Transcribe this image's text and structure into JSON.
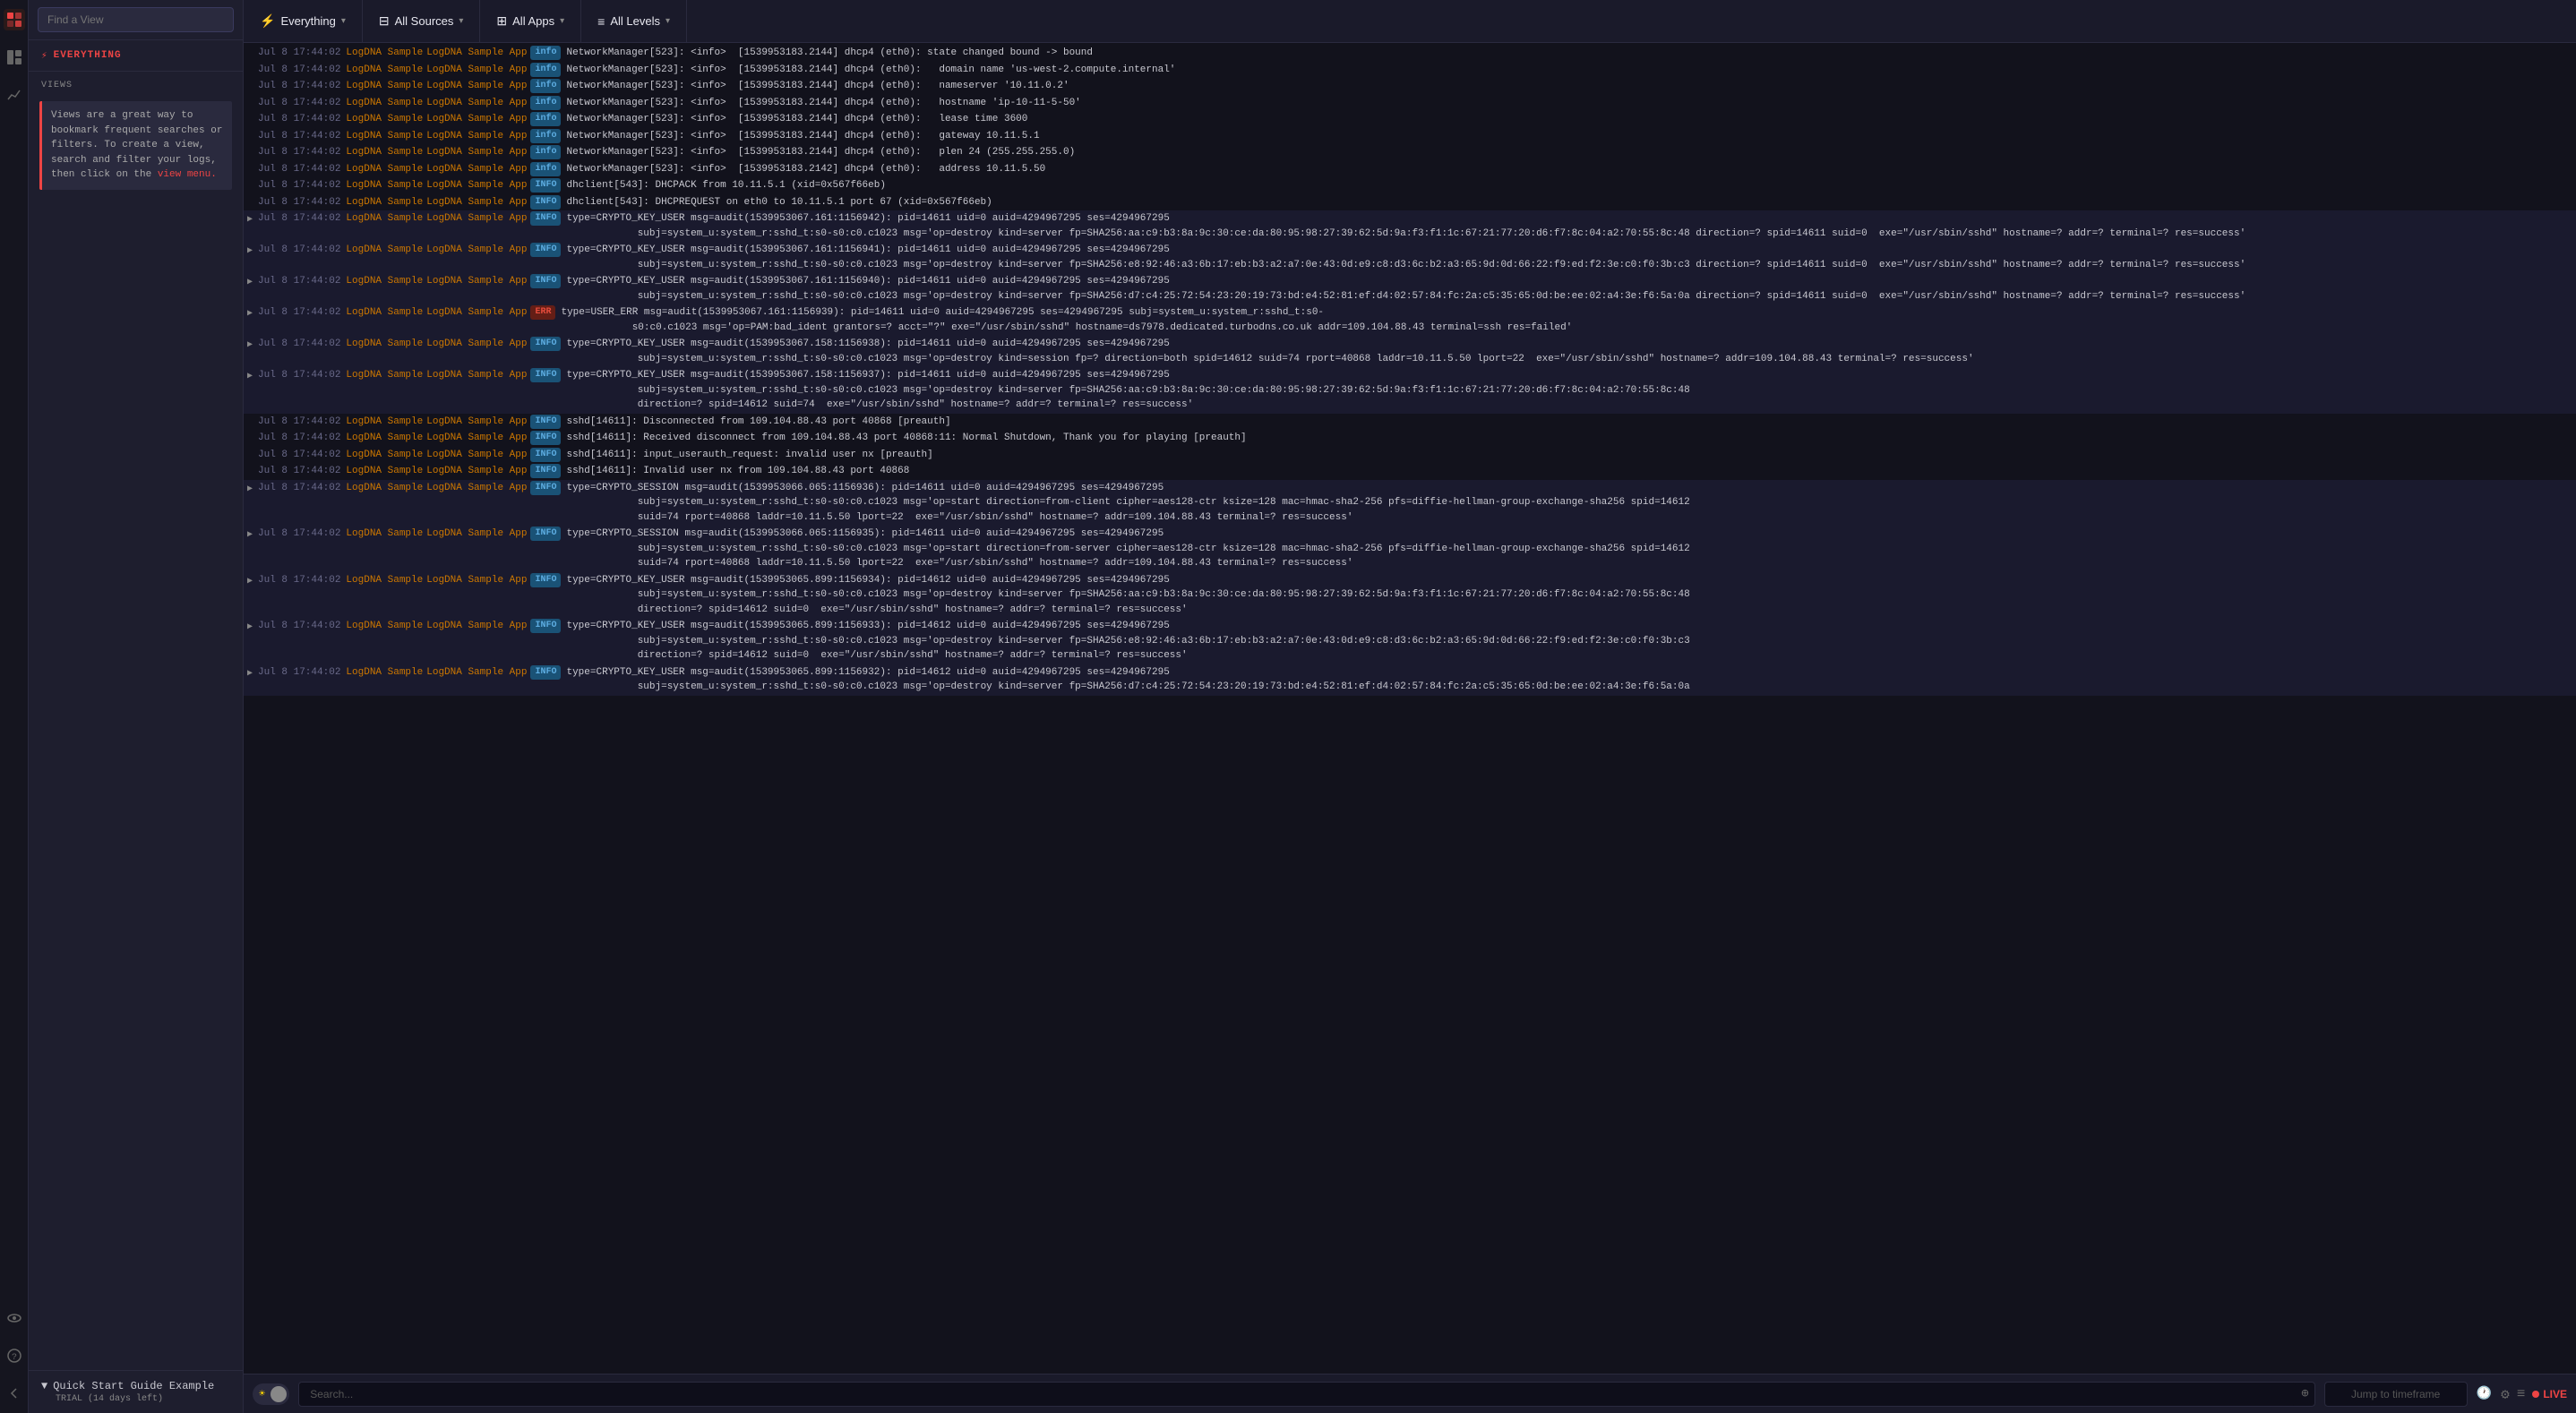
{
  "sidebar": {
    "find_view_placeholder": "Find a View",
    "everything_label": "EVERYTHING",
    "views_label": "VIEWS",
    "views_note": "Views are a great way to bookmark frequent searches or filters. To create a view, search and filter your logs, then click on the",
    "views_note_link": "view menu.",
    "quick_start": {
      "label": "Quick Start Guide Example",
      "trial": "TRIAL (14 days left)"
    }
  },
  "topbar": {
    "everything_label": "Everything",
    "all_sources_label": "All Sources",
    "all_apps_label": "All Apps",
    "all_levels_label": "All Levels"
  },
  "logs": [
    {
      "timestamp": "Jul 8 17:44:02",
      "source": "LogDNA Sample",
      "app": "LogDNA Sample App",
      "level": "info",
      "message": "NetworkManager[523]: <info>  [1539953183.2144] dhcp4 (eth0): state changed bound -> bound"
    },
    {
      "timestamp": "Jul 8 17:44:02",
      "source": "LogDNA Sample",
      "app": "LogDNA Sample App",
      "level": "info",
      "message": "NetworkManager[523]: <info>  [1539953183.2144] dhcp4 (eth0):   domain name 'us-west-2.compute.internal'"
    },
    {
      "timestamp": "Jul 8 17:44:02",
      "source": "LogDNA Sample",
      "app": "LogDNA Sample App",
      "level": "info",
      "message": "NetworkManager[523]: <info>  [1539953183.2144] dhcp4 (eth0):   nameserver '10.11.0.2'"
    },
    {
      "timestamp": "Jul 8 17:44:02",
      "source": "LogDNA Sample",
      "app": "LogDNA Sample App",
      "level": "info",
      "message": "NetworkManager[523]: <info>  [1539953183.2144] dhcp4 (eth0):   hostname 'ip-10-11-5-50'"
    },
    {
      "timestamp": "Jul 8 17:44:02",
      "source": "LogDNA Sample",
      "app": "LogDNA Sample App",
      "level": "info",
      "message": "NetworkManager[523]: <info>  [1539953183.2144] dhcp4 (eth0):   lease time 3600"
    },
    {
      "timestamp": "Jul 8 17:44:02",
      "source": "LogDNA Sample",
      "app": "LogDNA Sample App",
      "level": "info",
      "message": "NetworkManager[523]: <info>  [1539953183.2144] dhcp4 (eth0):   gateway 10.11.5.1"
    },
    {
      "timestamp": "Jul 8 17:44:02",
      "source": "LogDNA Sample",
      "app": "LogDNA Sample App",
      "level": "info",
      "message": "NetworkManager[523]: <info>  [1539953183.2144] dhcp4 (eth0):   plen 24 (255.255.255.0)"
    },
    {
      "timestamp": "Jul 8 17:44:02",
      "source": "LogDNA Sample",
      "app": "LogDNA Sample App",
      "level": "info",
      "message": "NetworkManager[523]: <info>  [1539953183.2142] dhcp4 (eth0):   address 10.11.5.50"
    },
    {
      "timestamp": "Jul 8 17:44:02",
      "source": "LogDNA Sample",
      "app": "LogDNA Sample App",
      "level": "INFO",
      "message": "dhclient[543]: DHCPACK from 10.11.5.1 (xid=0x567f66eb)"
    },
    {
      "timestamp": "Jul 8 17:44:02",
      "source": "LogDNA Sample",
      "app": "LogDNA Sample App",
      "level": "INFO",
      "message": "dhclient[543]: DHCPREQUEST on eth0 to 10.11.5.1 port 67 (xid=0x567f66eb)"
    },
    {
      "timestamp": "Jul 8 17:44:02",
      "source": "LogDNA Sample",
      "app": "LogDNA Sample App",
      "level": "INFO",
      "message": "type=CRYPTO_KEY_USER msg=audit(1539953067.161:1156942): pid=14611 uid=0 auid=4294967295 ses=4294967295\n      subj=system_u:system_r:sshd_t:s0-s0:c0.c1023 msg='op=destroy kind=server fp=SHA256:aa:c9:b3:8a:9c:30:ce:da:80:95:98:27:39:62:5d:9a:f3:f1:1c:67:21:77:20:d6:f7:8c:04:a2:70:55:8c:48 direction=? spid=14611 suid=0  exe=\"/usr/sbin/sshd\" hostname=? addr=? terminal=? res=success'"
    },
    {
      "timestamp": "Jul 8 17:44:02",
      "source": "LogDNA Sample",
      "app": "LogDNA Sample App",
      "level": "INFO",
      "message": "type=CRYPTO_KEY_USER msg=audit(1539953067.161:1156941): pid=14611 uid=0 auid=4294967295 ses=4294967295\n      subj=system_u:system_r:sshd_t:s0-s0:c0.c1023 msg='op=destroy kind=server fp=SHA256:e8:92:46:a3:6b:17:eb:b3:a2:a7:0e:43:0d:e9:c8:d3:6c:b2:a3:65:9d:0d:66:22:f9:ed:f2:3e:c0:f0:3b:c3 direction=? spid=14611 suid=0  exe=\"/usr/sbin/sshd\" hostname=? addr=? terminal=? res=success'"
    },
    {
      "timestamp": "Jul 8 17:44:02",
      "source": "LogDNA Sample",
      "app": "LogDNA Sample App",
      "level": "INFO",
      "message": "type=CRYPTO_KEY_USER msg=audit(1539953067.161:1156940): pid=14611 uid=0 auid=4294967295 ses=4294967295\n      subj=system_u:system_r:sshd_t:s0-s0:c0.c1023 msg='op=destroy kind=server fp=SHA256:d7:c4:25:72:54:23:20:19:73:bd:e4:52:81:ef:d4:02:57:84:fc:2a:c5:35:65:0d:be:ee:02:a4:3e:f6:5a:0a direction=? spid=14611 suid=0  exe=\"/usr/sbin/sshd\" hostname=? addr=? terminal=? res=success'"
    },
    {
      "timestamp": "Jul 8 17:44:02",
      "source": "LogDNA Sample",
      "app": "LogDNA Sample App",
      "level": "ERR",
      "message": "type=USER_ERR msg=audit(1539953067.161:1156939): pid=14611 uid=0 auid=4294967295 ses=4294967295 subj=system_u:system_r:sshd_t:s0-\n      s0:c0.c1023 msg='op=PAM:bad_ident grantors=? acct=\"?\" exe=\"/usr/sbin/sshd\" hostname=ds7978.dedicated.turbodns.co.uk addr=109.104.88.43 terminal=ssh res=failed'"
    },
    {
      "timestamp": "Jul 8 17:44:02",
      "source": "LogDNA Sample",
      "app": "LogDNA Sample App",
      "level": "INFO",
      "message": "type=CRYPTO_KEY_USER msg=audit(1539953067.158:1156938): pid=14611 uid=0 auid=4294967295 ses=4294967295\n      subj=system_u:system_r:sshd_t:s0-s0:c0.c1023 msg='op=destroy kind=session fp=? direction=both spid=14612 suid=74 rport=40868 laddr=10.11.5.50 lport=22  exe=\"/usr/sbin/sshd\" hostname=? addr=109.104.88.43 terminal=? res=success'"
    },
    {
      "timestamp": "Jul 8 17:44:02",
      "source": "LogDNA Sample",
      "app": "LogDNA Sample App",
      "level": "INFO",
      "message": "type=CRYPTO_KEY_USER msg=audit(1539953067.158:1156937): pid=14611 uid=0 auid=4294967295 ses=4294967295\n      subj=system_u:system_r:sshd_t:s0-s0:c0.c1023 msg='op=destroy kind=server fp=SHA256:aa:c9:b3:8a:9c:30:ce:da:80:95:98:27:39:62:5d:9a:f3:f1:1c:67:21:77:20:d6:f7:8c:04:a2:70:55:8c:48\n      direction=? spid=14612 suid=74  exe=\"/usr/sbin/sshd\" hostname=? addr=? terminal=? res=success'"
    },
    {
      "timestamp": "Jul 8 17:44:02",
      "source": "LogDNA Sample",
      "app": "LogDNA Sample App",
      "level": "INFO",
      "message": "sshd[14611]: Disconnected from 109.104.88.43 port 40868 [preauth]"
    },
    {
      "timestamp": "Jul 8 17:44:02",
      "source": "LogDNA Sample",
      "app": "LogDNA Sample App",
      "level": "INFO",
      "message": "sshd[14611]: Received disconnect from 109.104.88.43 port 40868:11: Normal Shutdown, Thank you for playing [preauth]"
    },
    {
      "timestamp": "Jul 8 17:44:02",
      "source": "LogDNA Sample",
      "app": "LogDNA Sample App",
      "level": "INFO",
      "message": "sshd[14611]: input_userauth_request: invalid user nx [preauth]"
    },
    {
      "timestamp": "Jul 8 17:44:02",
      "source": "LogDNA Sample",
      "app": "LogDNA Sample App",
      "level": "INFO",
      "message": "sshd[14611]: Invalid user nx from 109.104.88.43 port 40868"
    },
    {
      "timestamp": "Jul 8 17:44:02",
      "source": "LogDNA Sample",
      "app": "LogDNA Sample App",
      "level": "INFO",
      "message": "type=CRYPTO_SESSION msg=audit(1539953066.065:1156936): pid=14611 uid=0 auid=4294967295 ses=4294967295\n      subj=system_u:system_r:sshd_t:s0-s0:c0.c1023 msg='op=start direction=from-client cipher=aes128-ctr ksize=128 mac=hmac-sha2-256 pfs=diffie-hellman-group-exchange-sha256 spid=14612\n      suid=74 rport=40868 laddr=10.11.5.50 lport=22  exe=\"/usr/sbin/sshd\" hostname=? addr=109.104.88.43 terminal=? res=success'"
    },
    {
      "timestamp": "Jul 8 17:44:02",
      "source": "LogDNA Sample",
      "app": "LogDNA Sample App",
      "level": "INFO",
      "message": "type=CRYPTO_SESSION msg=audit(1539953066.065:1156935): pid=14611 uid=0 auid=4294967295 ses=4294967295\n      subj=system_u:system_r:sshd_t:s0-s0:c0.c1023 msg='op=start direction=from-server cipher=aes128-ctr ksize=128 mac=hmac-sha2-256 pfs=diffie-hellman-group-exchange-sha256 spid=14612\n      suid=74 rport=40868 laddr=10.11.5.50 lport=22  exe=\"/usr/sbin/sshd\" hostname=? addr=109.104.88.43 terminal=? res=success'"
    },
    {
      "timestamp": "Jul 8 17:44:02",
      "source": "LogDNA Sample",
      "app": "LogDNA Sample App",
      "level": "INFO",
      "message": "type=CRYPTO_KEY_USER msg=audit(1539953065.899:1156934): pid=14612 uid=0 auid=4294967295 ses=4294967295\n      subj=system_u:system_r:sshd_t:s0-s0:c0.c1023 msg='op=destroy kind=server fp=SHA256:aa:c9:b3:8a:9c:30:ce:da:80:95:98:27:39:62:5d:9a:f3:f1:1c:67:21:77:20:d6:f7:8c:04:a2:70:55:8c:48\n      direction=? spid=14612 suid=0  exe=\"/usr/sbin/sshd\" hostname=? addr=? terminal=? res=success'"
    },
    {
      "timestamp": "Jul 8 17:44:02",
      "source": "LogDNA Sample",
      "app": "LogDNA Sample App",
      "level": "INFO",
      "message": "type=CRYPTO_KEY_USER msg=audit(1539953065.899:1156933): pid=14612 uid=0 auid=4294967295 ses=4294967295\n      subj=system_u:system_r:sshd_t:s0-s0:c0.c1023 msg='op=destroy kind=server fp=SHA256:e8:92:46:a3:6b:17:eb:b3:a2:a7:0e:43:0d:e9:c8:d3:6c:b2:a3:65:9d:0d:66:22:f9:ed:f2:3e:c0:f0:3b:c3\n      direction=? spid=14612 suid=0  exe=\"/usr/sbin/sshd\" hostname=? addr=? terminal=? res=success'"
    },
    {
      "timestamp": "Jul 8 17:44:02",
      "source": "LogDNA Sample",
      "app": "LogDNA Sample App",
      "level": "INFO",
      "message": "type=CRYPTO_KEY_USER msg=audit(1539953065.899:1156932): pid=14612 uid=0 auid=4294967295 ses=4294967295\n      subj=system_u:system_r:sshd_t:s0-s0:c0.c1023 msg='op=destroy kind=server fp=SHA256:d7:c4:25:72:54:23:20:19:73:bd:e4:52:81:ef:d4:02:57:84:fc:2a:c5:35:65:0d:be:ee:02:a4:3e:f6:5a:0a"
    }
  ],
  "bottombar": {
    "search_placeholder": "Search...",
    "timeframe_placeholder": "Jump to timeframe",
    "live_label": "LIVE"
  },
  "icons": {
    "bolt": "⚡",
    "layers": "⊟",
    "apps": "⊞",
    "levels": "≡",
    "chevron_down": "▾",
    "search": "⊕",
    "clock": "🕐",
    "sun": "☀",
    "moon": "☽",
    "eye": "👁",
    "settings": "⚙",
    "help": "?",
    "arrow_left": "←",
    "caret_right": "▶",
    "minus": "—",
    "expand": "▼",
    "alert": "🔔",
    "graph": "📊",
    "tag": "🏷",
    "shield": "🛡"
  }
}
